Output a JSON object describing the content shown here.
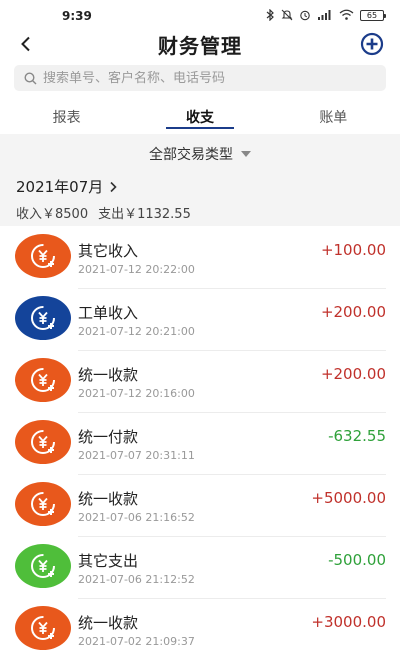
{
  "status_bar": {
    "time": "9:39",
    "battery": "65"
  },
  "header": {
    "title": "财务管理"
  },
  "search": {
    "placeholder": "搜索单号、客户名称、电话号码"
  },
  "tabs": [
    {
      "label": "报表",
      "active": false
    },
    {
      "label": "收支",
      "active": true
    },
    {
      "label": "账单",
      "active": false
    }
  ],
  "filter": {
    "label": "全部交易类型"
  },
  "month": {
    "label": "2021年07月"
  },
  "summary": {
    "income": "收入￥8500",
    "expense": "支出￥1132.55"
  },
  "colors": {
    "orange": "#e8581c",
    "navy": "#14449a",
    "green": "#4fbe3a",
    "positive": "#c0312b",
    "negative": "#2fa13a",
    "accent": "#1b3c8a"
  },
  "transactions": [
    {
      "title": "其它收入",
      "date": "2021-07-12 20:22:00",
      "amount": "+100.00",
      "type": "pos",
      "icon": "orange"
    },
    {
      "title": "工单收入",
      "date": "2021-07-12 20:21:00",
      "amount": "+200.00",
      "type": "pos",
      "icon": "navy"
    },
    {
      "title": "统一收款",
      "date": "2021-07-12 20:16:00",
      "amount": "+200.00",
      "type": "pos",
      "icon": "orange"
    },
    {
      "title": "统一付款",
      "date": "2021-07-07 20:31:11",
      "amount": "-632.55",
      "type": "neg",
      "icon": "orange"
    },
    {
      "title": "统一收款",
      "date": "2021-07-06 21:16:52",
      "amount": "+5000.00",
      "type": "pos",
      "icon": "orange"
    },
    {
      "title": "其它支出",
      "date": "2021-07-06 21:12:52",
      "amount": "-500.00",
      "type": "neg",
      "icon": "green"
    },
    {
      "title": "统一收款",
      "date": "2021-07-02 21:09:37",
      "amount": "+3000.00",
      "type": "pos",
      "icon": "orange"
    }
  ]
}
